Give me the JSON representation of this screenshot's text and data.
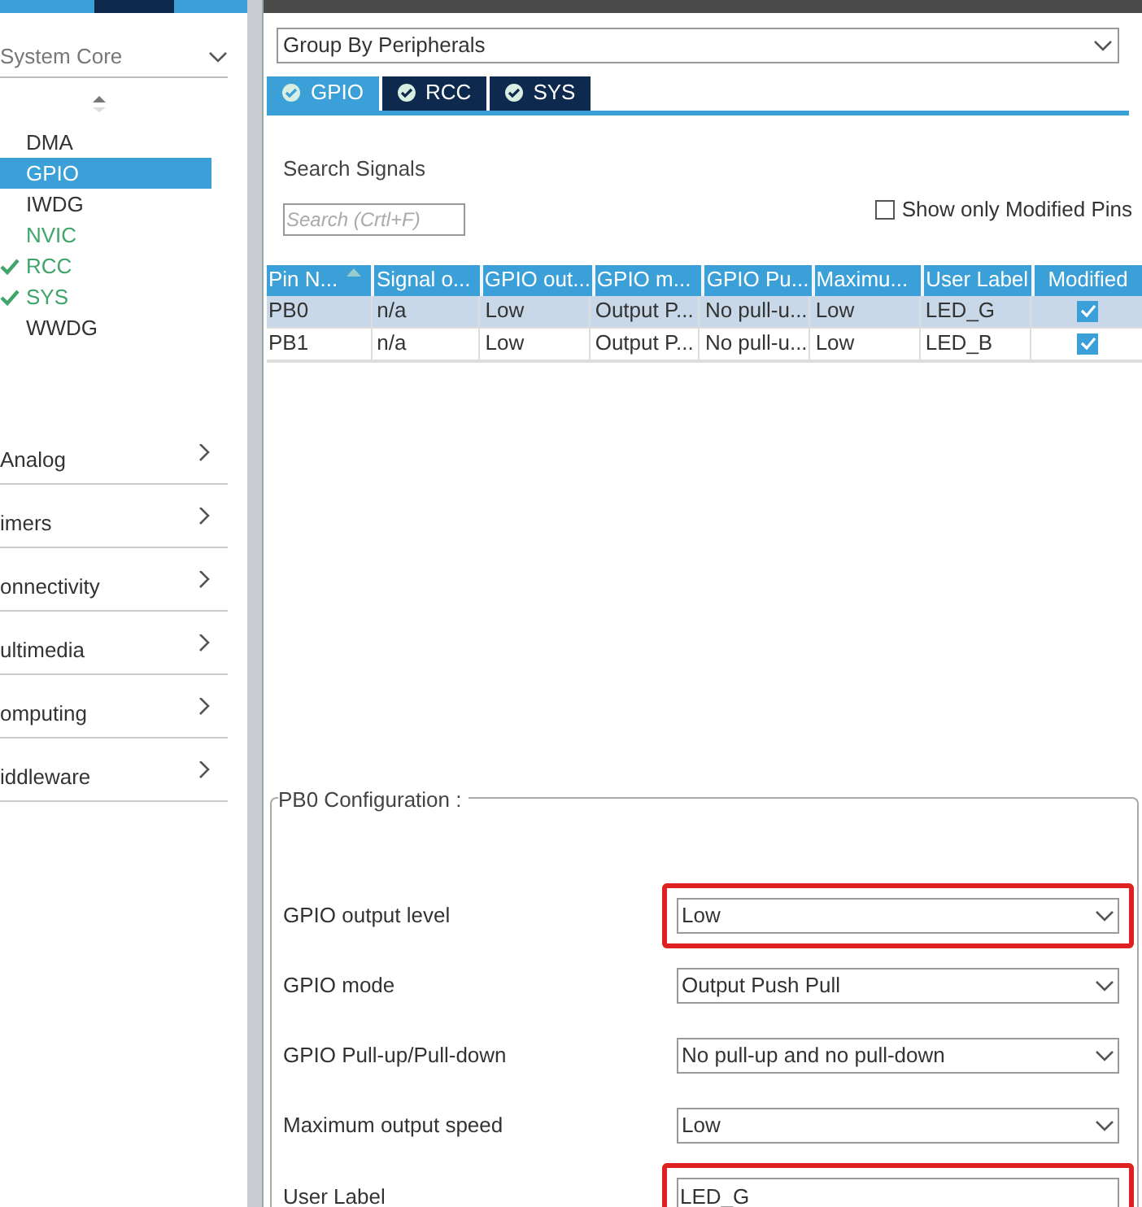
{
  "sidebar": {
    "category": {
      "label": "System Core",
      "expanded": true
    },
    "items": [
      {
        "label": "DMA",
        "selected": false,
        "configured": false,
        "modified": false
      },
      {
        "label": "GPIO",
        "selected": true,
        "configured": false,
        "modified": false
      },
      {
        "label": "IWDG",
        "selected": false,
        "configured": false,
        "modified": false
      },
      {
        "label": "NVIC",
        "selected": false,
        "configured": false,
        "modified": true
      },
      {
        "label": "RCC",
        "selected": false,
        "configured": true,
        "modified": true
      },
      {
        "label": "SYS",
        "selected": false,
        "configured": true,
        "modified": true
      },
      {
        "label": "WWDG",
        "selected": false,
        "configured": false,
        "modified": false
      }
    ],
    "categories": [
      {
        "label": "Analog",
        "expanded": false
      },
      {
        "label": "imers",
        "expanded": false
      },
      {
        "label": "onnectivity",
        "expanded": false
      },
      {
        "label": "ultimedia",
        "expanded": false
      },
      {
        "label": "omputing",
        "expanded": false
      },
      {
        "label": "iddleware",
        "expanded": false
      }
    ]
  },
  "group_by": {
    "value": "Group By Peripherals"
  },
  "tabs": [
    {
      "label": "GPIO",
      "selected": true
    },
    {
      "label": "RCC",
      "selected": false
    },
    {
      "label": "SYS",
      "selected": false
    }
  ],
  "search": {
    "label": "Search Signals",
    "placeholder": "Search (Crtl+F)"
  },
  "modified_only": {
    "label": "Show only Modified Pins",
    "checked": false
  },
  "table": {
    "columns": [
      {
        "label": "Pin N...",
        "sorted": true
      },
      {
        "label": "Signal o...",
        "sorted": false
      },
      {
        "label": "GPIO out...",
        "sorted": false
      },
      {
        "label": "GPIO m...",
        "sorted": false
      },
      {
        "label": "GPIO Pu...",
        "sorted": false
      },
      {
        "label": "Maximu...",
        "sorted": false
      },
      {
        "label": "User Label",
        "sorted": false
      },
      {
        "label": "Modified",
        "sorted": false
      }
    ],
    "rows": [
      {
        "cells": [
          "PB0",
          "n/a",
          "Low",
          "Output P...",
          "No pull-u...",
          "Low",
          "LED_G"
        ],
        "modified": true,
        "selected": true
      },
      {
        "cells": [
          "PB1",
          "n/a",
          "Low",
          "Output P...",
          "No pull-u...",
          "Low",
          "LED_B"
        ],
        "modified": true,
        "selected": false
      }
    ]
  },
  "config": {
    "title": "PB0 Configuration :",
    "fields": [
      {
        "label": "GPIO output level",
        "kind": "select",
        "value": "Low",
        "highlighted": true
      },
      {
        "label": "GPIO mode",
        "kind": "select",
        "value": "Output Push Pull",
        "highlighted": false
      },
      {
        "label": "GPIO Pull-up/Pull-down",
        "kind": "select",
        "value": "No pull-up and no pull-down",
        "highlighted": false
      },
      {
        "label": "Maximum output speed",
        "kind": "select",
        "value": "Low",
        "highlighted": false
      },
      {
        "label": "User Label",
        "kind": "text",
        "value": "LED_G",
        "highlighted": true
      }
    ]
  }
}
